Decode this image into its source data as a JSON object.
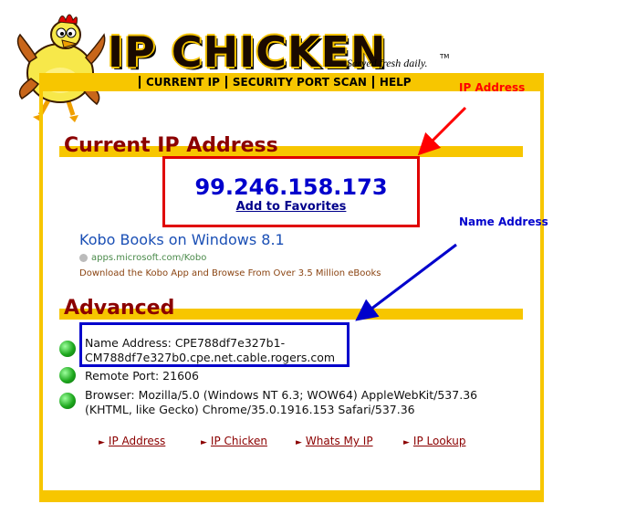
{
  "logo": {
    "title": "IP CHICKEN",
    "tagline": "Served fresh daily.",
    "tm": "TM",
    "mascot_icon": "chicken-mascot-icon"
  },
  "nav": {
    "items": [
      "CURRENT IP",
      "SECURITY PORT SCAN",
      "HELP"
    ]
  },
  "current_ip": {
    "heading": "Current IP Address",
    "ip": "99.246.158.173",
    "favorites_label": "Add to Favorites"
  },
  "ad": {
    "title": "Kobo Books on Windows 8.1",
    "url": "apps.microsoft.com/Kobo",
    "description": "Download the Kobo App and Browse From Over 3.5 Million eBooks"
  },
  "advanced": {
    "heading": "Advanced",
    "name_address_line1": "Name Address: CPE788df7e327b1-",
    "name_address_line2": "CM788df7e327b0.cpe.net.cable.rogers.com",
    "remote_port": "Remote Port: 21606",
    "browser_line1": "Browser: Mozilla/5.0 (Windows NT 6.3; WOW64) AppleWebKit/537.36",
    "browser_line2": "(KHTML, like Gecko) Chrome/35.0.1916.153 Safari/537.36"
  },
  "footer_links": [
    "IP Address",
    "IP Chicken",
    "Whats My IP",
    "IP Lookup"
  ],
  "annotations": {
    "ip_label": "IP Address",
    "name_label": "Name Address"
  },
  "colors": {
    "yellow": "#f7c600",
    "dark_red": "#8b0000",
    "red": "#e00000",
    "blue": "#0000cc"
  }
}
